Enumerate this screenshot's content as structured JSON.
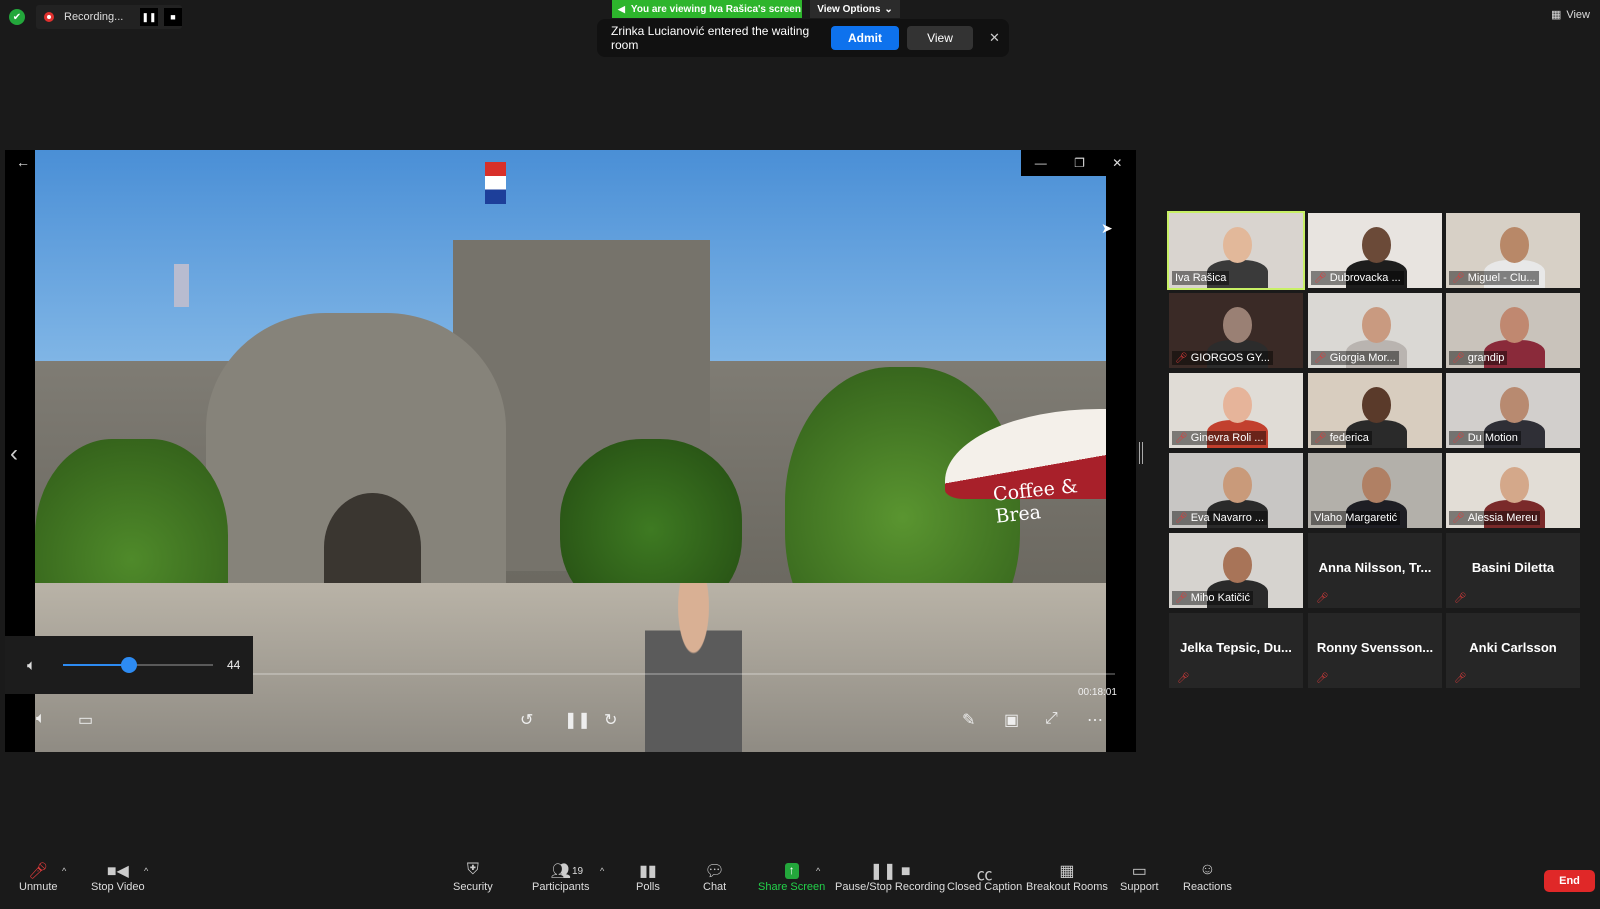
{
  "topbar": {
    "recording_label": "Recording...",
    "pause_icon": "pause-icon",
    "stop_icon": "stop-icon",
    "view_label": "View"
  },
  "share_banner": {
    "text": "You are viewing Iva Rašica's screen",
    "view_options": "View Options"
  },
  "notification": {
    "message": "Zrinka Lucianović entered the waiting room",
    "admit_label": "Admit",
    "view_label": "View"
  },
  "player": {
    "volume_value": "44",
    "volume_percent": 44,
    "time": "00:18:01",
    "umbrella_text": "Coffee & Brea"
  },
  "participants": [
    {
      "name": "Iva Rašica",
      "video": true,
      "active": true,
      "muted": false,
      "bg": "#d9d4cf",
      "face": "#e2b89a",
      "body": "#3a3a3a"
    },
    {
      "name": "Dubrovacka ...",
      "video": true,
      "muted": true,
      "bg": "#e8e4e0",
      "face": "#6b4a38",
      "body": "#1d1d1d"
    },
    {
      "name": "Miguel - Clu...",
      "video": true,
      "muted": true,
      "bg": "#d7d0c6",
      "face": "#b88868",
      "body": "#e8e8e8"
    },
    {
      "name": "GIORGOS GY...",
      "video": true,
      "muted": true,
      "bg": "#3a2a26",
      "face": "#9a8074",
      "body": "#2c2c2c"
    },
    {
      "name": "Giorgia Mor...",
      "video": true,
      "muted": true,
      "bg": "#dad8d4",
      "face": "#c99a80",
      "body": "#b9b4b0"
    },
    {
      "name": "grandip",
      "video": true,
      "muted": true,
      "bg": "#c9c3bb",
      "face": "#c08870",
      "body": "#8a2a3a"
    },
    {
      "name": "Ginevra Roli ...",
      "video": true,
      "muted": true,
      "bg": "#e0dcd6",
      "face": "#e6b49a",
      "body": "#c2402e"
    },
    {
      "name": "federica",
      "video": true,
      "muted": true,
      "bg": "#d8cdbf",
      "face": "#5a3a2a",
      "body": "#2a2a2a"
    },
    {
      "name": "Du Motion",
      "video": true,
      "muted": true,
      "bg": "#d2cfcc",
      "face": "#b88a70",
      "body": "#2f2f36"
    },
    {
      "name": "Eva Navarro ...",
      "video": true,
      "muted": true,
      "bg": "#c8c6c4",
      "face": "#c99a7a",
      "body": "#2a2a2a"
    },
    {
      "name": "Vlaho Margaretić",
      "video": true,
      "muted": false,
      "bg": "#b3b0aa",
      "face": "#b08064",
      "body": "#1e1e24"
    },
    {
      "name": "Alessia Mereu",
      "video": true,
      "muted": true,
      "bg": "#e2ddd6",
      "face": "#d4a88a",
      "body": "#7a2a2a"
    },
    {
      "name": "Miho Katičić",
      "video": true,
      "muted": true,
      "bg": "#d6d3cf",
      "face": "#a87458",
      "body": "#2a2a2a"
    },
    {
      "name": "Anna Nilsson, Tr...",
      "video": false,
      "muted": true
    },
    {
      "name": "Basini Diletta",
      "video": false,
      "muted": true
    },
    {
      "name": "Jelka Tepsic, Du...",
      "video": false,
      "muted": true
    },
    {
      "name": "Ronny Svensson...",
      "video": false,
      "muted": true
    },
    {
      "name": "Anki Carlsson",
      "video": false,
      "muted": true
    }
  ],
  "toolbar": {
    "unmute": "Unmute",
    "stop_video": "Stop Video",
    "security": "Security",
    "participants": "Participants",
    "participants_count": "19",
    "polls": "Polls",
    "chat": "Chat",
    "share_screen": "Share Screen",
    "pause_stop_recording": "Pause/Stop Recording",
    "closed_caption": "Closed Caption",
    "breakout_rooms": "Breakout Rooms",
    "support": "Support",
    "reactions": "Reactions",
    "end": "End"
  },
  "colors": {
    "accent_blue": "#0e72ed",
    "share_green": "#23a73b",
    "end_red": "#e02828",
    "active_speaker": "#c8f066"
  }
}
